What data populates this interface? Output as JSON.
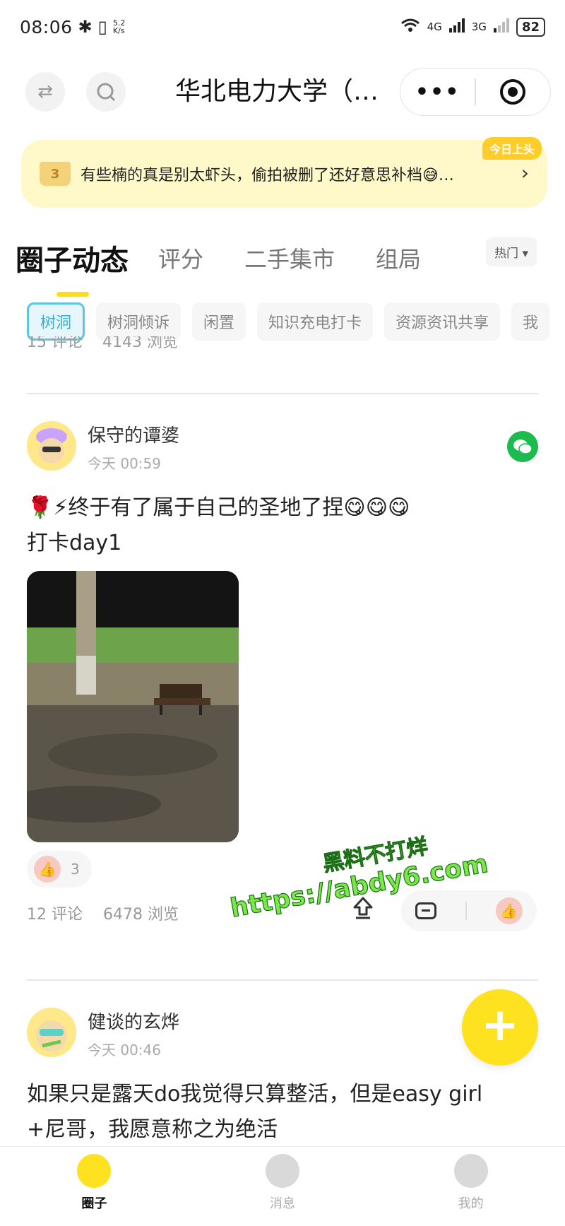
{
  "status_bar": {
    "time": "08:06",
    "net_speed_top": "5.2",
    "net_speed_bottom": "K/s",
    "signal_1": "4G",
    "signal_2": "3G",
    "battery": "82"
  },
  "header": {
    "title": "华北电力大学（…",
    "more_label": "•••"
  },
  "banner": {
    "rank": "3",
    "text": "有些楠的真是别太虾头，偷拍被删了还好意思补档😅…",
    "badge": "今日上头",
    "chevron": "›"
  },
  "tabs": [
    {
      "label": "圈子动态"
    },
    {
      "label": "评分"
    },
    {
      "label": "二手集市"
    },
    {
      "label": "组局"
    }
  ],
  "sort": {
    "label": "热门 ▾"
  },
  "chips": [
    {
      "label": "树洞"
    },
    {
      "label": "树洞倾诉"
    },
    {
      "label": "闲置"
    },
    {
      "label": "知识充电打卡"
    },
    {
      "label": "资源资讯共享"
    },
    {
      "label": "我"
    }
  ],
  "prev_post": {
    "comments": "15 评论",
    "views": "4143 浏览"
  },
  "posts": [
    {
      "author": "保守的谭婆",
      "time": "今天 00:59",
      "text_line1": "🌹⚡终于有了属于自己的圣地了捏😋😋😋",
      "text_line2": "打卡day1",
      "likes": "3",
      "comments": "12 评论",
      "views": "6478 浏览"
    },
    {
      "author": "健谈的玄烨",
      "time": "今天 00:46",
      "text_line1": "如果只是露天do我觉得只算整活，但是easy girl",
      "text_line2": "+尼哥，我愿意称之为绝活"
    }
  ],
  "watermark": {
    "line1": "黑料不打烊",
    "line2": "https://abdy6.com"
  },
  "fab": {
    "label": "+"
  },
  "bottom_nav": [
    {
      "label": "圈子"
    },
    {
      "label": "消息"
    },
    {
      "label": "我的"
    }
  ],
  "colors": {
    "accent_yellow": "#ffdd16",
    "banner_bg": "#fff8c8",
    "chip_active": "#5cc6e6",
    "wechat_green": "#1bbb4e"
  }
}
